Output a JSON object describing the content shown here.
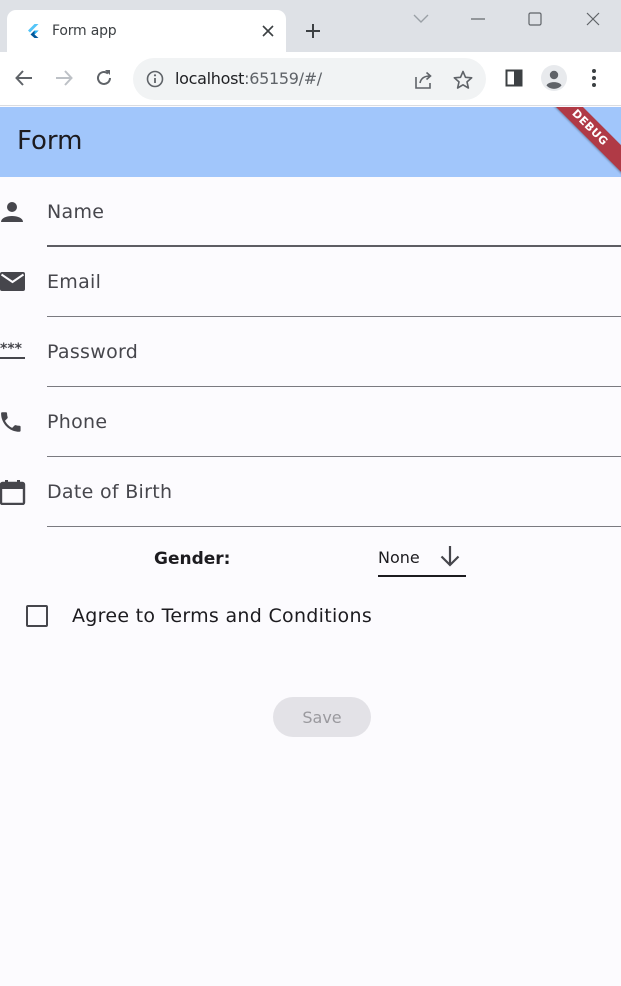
{
  "browser": {
    "tab_title": "Form app",
    "url_host": "localhost",
    "url_rest": ":65159/#/",
    "icons": [
      "flutter-favicon-icon",
      "close-icon",
      "plus-icon",
      "chevron-down-icon",
      "minimize-icon",
      "maximize-icon",
      "close-window-icon",
      "back-arrow-icon",
      "forward-arrow-icon",
      "reload-icon",
      "info-icon",
      "share-icon",
      "star-icon",
      "side-panel-icon",
      "profile-icon",
      "kebab-menu-icon"
    ]
  },
  "app": {
    "title": "Form",
    "debug_banner": "DEBUG",
    "colors": {
      "appbar": "#a1c6fb",
      "background": "#fcfbfe",
      "debug": "#b03a46"
    }
  },
  "form": {
    "fields": [
      {
        "placeholder": "Name",
        "icon": "person-icon"
      },
      {
        "placeholder": "Email",
        "icon": "mail-icon"
      },
      {
        "placeholder": "Password",
        "icon": "password-icon"
      },
      {
        "placeholder": "Phone",
        "icon": "phone-icon"
      },
      {
        "placeholder": "Date of Birth",
        "icon": "calendar-icon"
      }
    ],
    "gender_label": "Gender:",
    "gender_value": "None",
    "terms_label": "Agree to Terms and Conditions",
    "terms_checked": false,
    "save_label": "Save"
  }
}
